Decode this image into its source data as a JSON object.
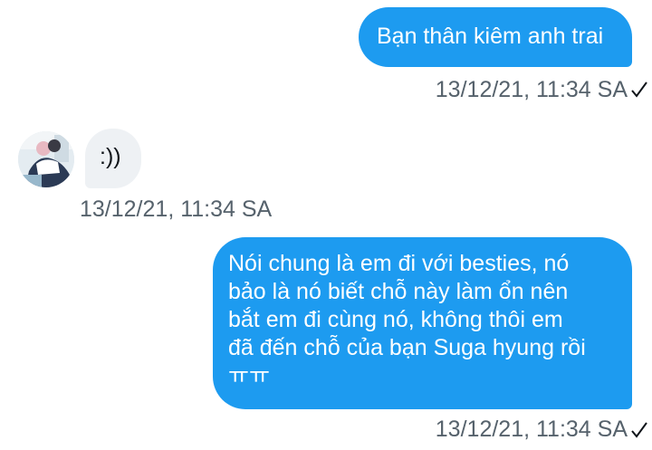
{
  "messages": [
    {
      "direction": "outgoing",
      "text": "Bạn thân kiêm anh trai",
      "timestamp": "13/12/21, 11:34 SA",
      "status_icon": "check-icon"
    },
    {
      "direction": "incoming",
      "text": ":))",
      "timestamp": "13/12/21, 11:34 SA",
      "avatar_icon": "avatar-photo"
    },
    {
      "direction": "outgoing",
      "lines": [
        "Nói chung là em đi với besties, nó",
        "bảo là nó biết chỗ này làm ổn nên",
        "bắt em đi cùng nó, không thôi em",
        "đã đến chỗ của bạn Suga hyung rồi",
        "ㅠㅠ"
      ],
      "timestamp": "13/12/21, 11:34 SA",
      "status_icon": "check-icon"
    }
  ],
  "colors": {
    "outgoing_bubble": "#1d9bf0",
    "incoming_bubble": "#eef1f4",
    "timestamp": "#56626c"
  }
}
